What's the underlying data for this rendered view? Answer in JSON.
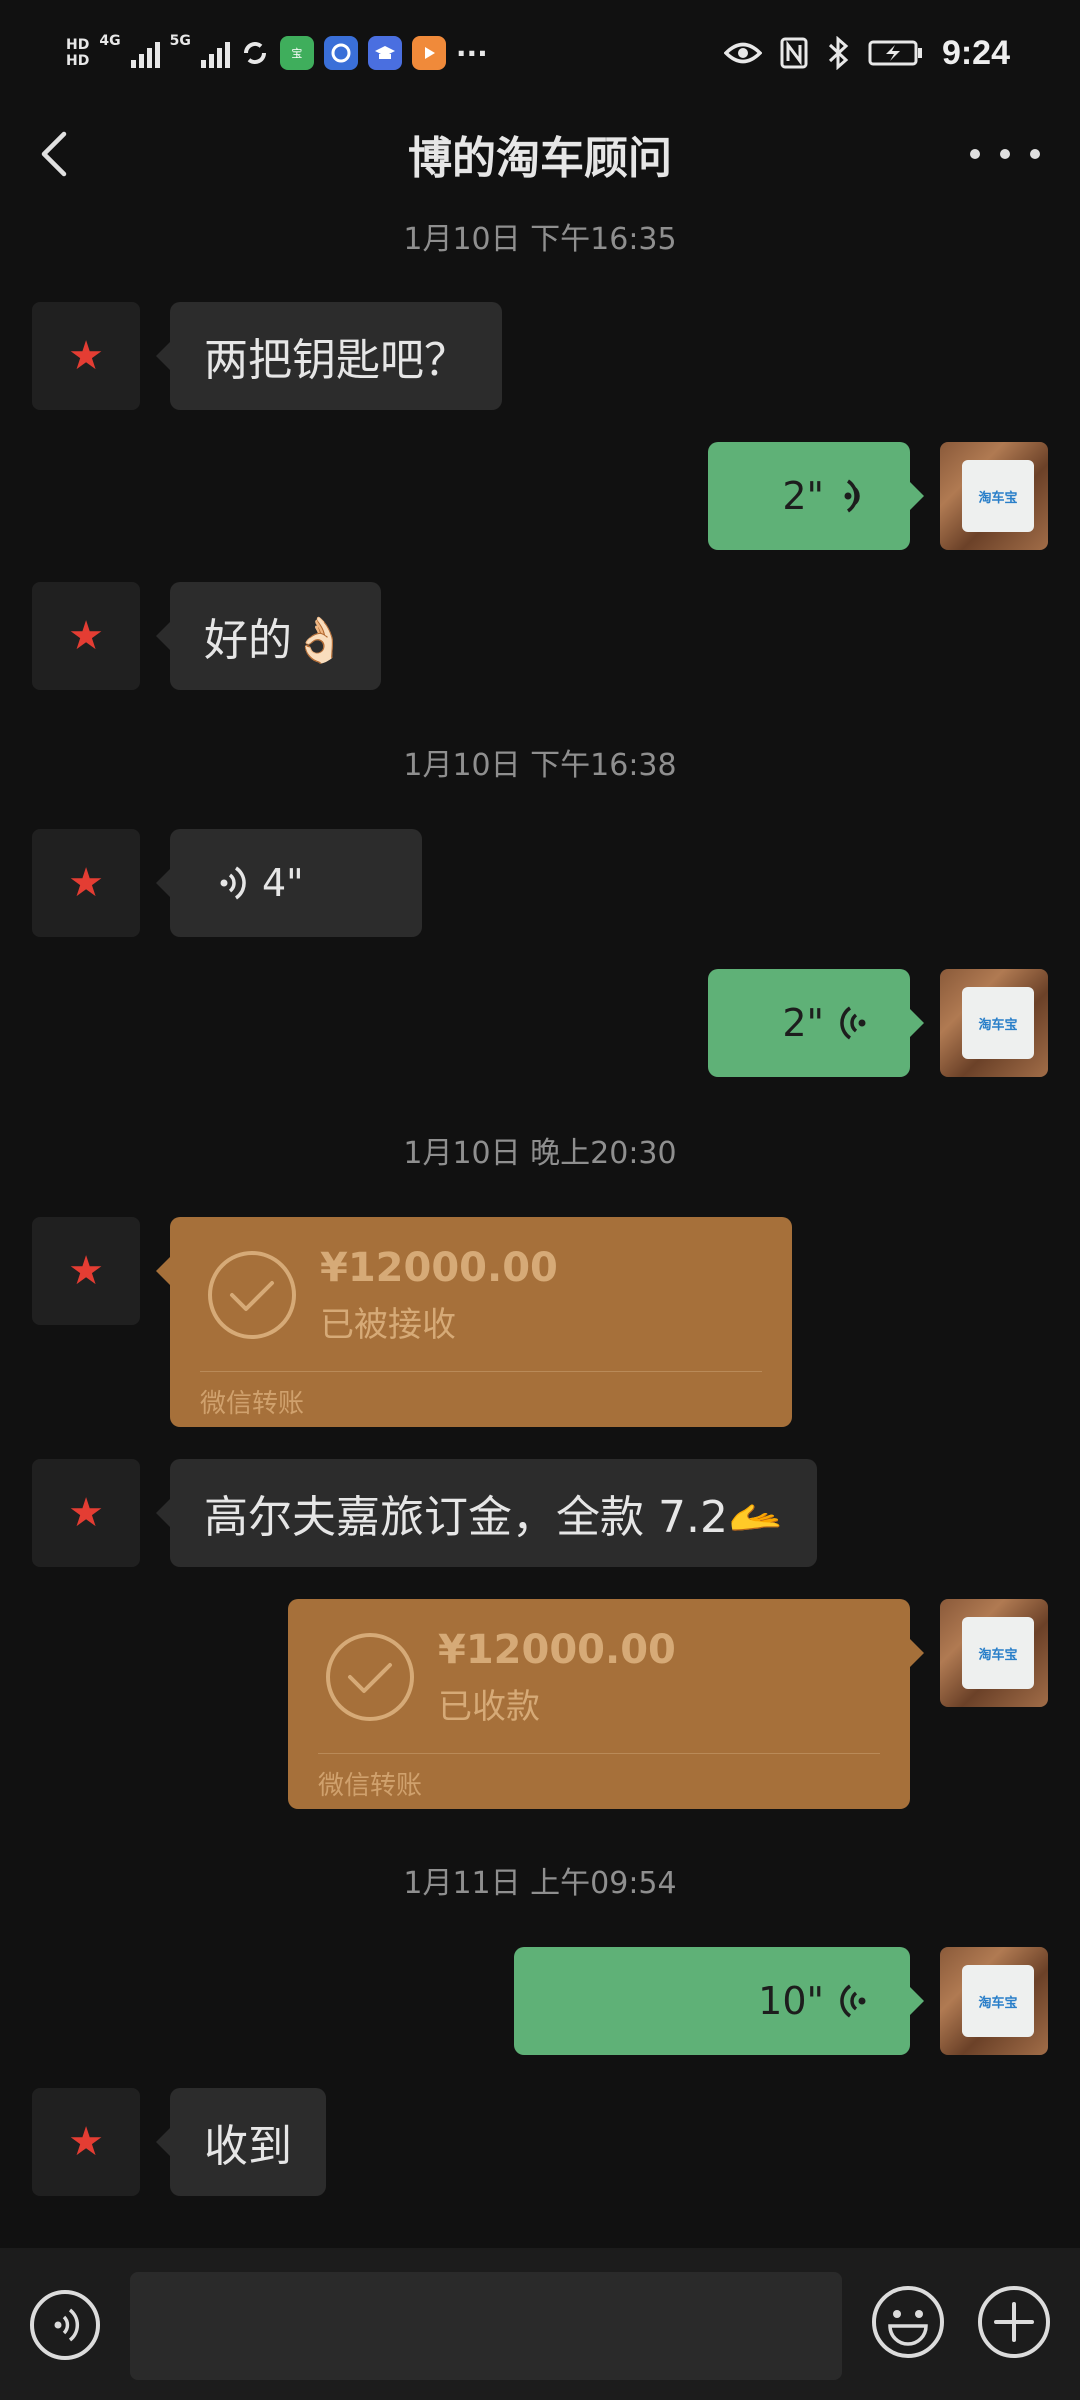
{
  "status_bar": {
    "hd_top": "HD",
    "hd_bottom": "HD",
    "net1": "4G",
    "net2": "5G",
    "app1_label": "宝",
    "time": "9:24",
    "more": "···"
  },
  "header": {
    "title": "博的淘车顾问",
    "back_icon": "chevron-left-icon",
    "more_icon": "more-dots-icon"
  },
  "brand_card_label": "淘车宝",
  "messages": {
    "t1": "1月10日 下午16:35",
    "m1": "两把钥匙吧？",
    "v1": "2\"",
    "m2": "好的👌🏻",
    "t2": "1月10日 下午16:38",
    "v2": "4\"",
    "v3": "2\"",
    "t3": "1月10日 晚上20:30",
    "tr1_amount": "¥12000.00",
    "tr1_status": "已被接收",
    "tr1_source": "微信转账",
    "m3": "高尔夫嘉旅订金，全款 7.2🫴",
    "tr2_amount": "¥12000.00",
    "tr2_status": "已收款",
    "tr2_source": "微信转账",
    "t4": "1月11日 上午09:54",
    "v4": "10\"",
    "m4": "收到"
  },
  "colors": {
    "background": "#111111",
    "bubble_other": "#2c2c2c",
    "bubble_self_voice": "#5fb177",
    "transfer": "#a6703a",
    "avatar_star": "#e43d33"
  }
}
